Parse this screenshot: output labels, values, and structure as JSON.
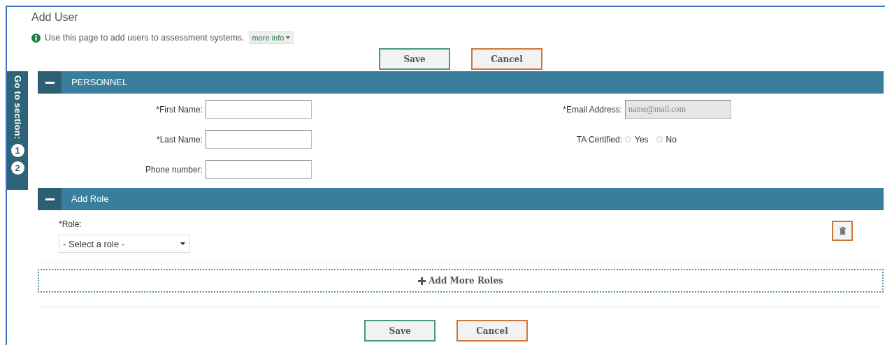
{
  "page": {
    "title": "Add User",
    "info": "Use this page to add users to assessment systems.",
    "more_info": "more info"
  },
  "top_buttons": [
    {
      "label": "Save",
      "kind": "primary"
    },
    {
      "label": "Cancel",
      "kind": "secondary"
    }
  ],
  "section_nav": {
    "label": "Go to section:",
    "items": [
      "1",
      "2"
    ]
  },
  "personnel": {
    "title": "PERSONNEL",
    "expanded": true,
    "left_fields": [
      {
        "label": "*First Name:"
      },
      {
        "label": "*Last Name:"
      },
      {
        "label": "Phone number:"
      }
    ],
    "email": {
      "label": "*Email Address:",
      "placeholder": "name@mail.com",
      "disabled": true
    },
    "ta_certified": {
      "label": "TA Certified:",
      "options": [
        {
          "label": "Yes",
          "selected": false
        },
        {
          "label": "No",
          "selected": false
        }
      ]
    }
  },
  "add_role": {
    "title": "Add Role",
    "expanded": true,
    "role_label": "*Role:",
    "role_value": "- Select a role -",
    "add_more": "Add More Roles"
  },
  "bottom_buttons": [
    {
      "label": "Save",
      "kind": "primary"
    },
    {
      "label": "Cancel",
      "kind": "secondary"
    }
  ]
}
